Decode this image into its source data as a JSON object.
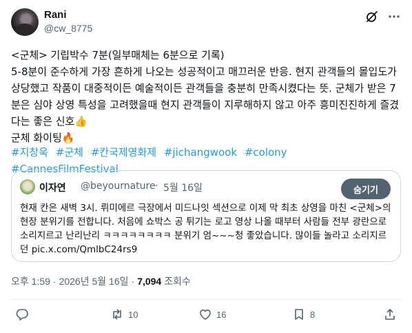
{
  "tweet": {
    "author_name": "Rani",
    "author_handle": "@cw_8775",
    "text": "<군체> 기립박수 7분(일부매체는 6분으로 기록)\n5-8분이 준수하게 가장 흔하게 나오는 성공적이고 매끄러운 반응. 현지 관객들의 몰입도가 상당했고 작품이 대중적이든 예술적이든 관객들을 충분히 만족시켰다는 뜻. 군체가 받은 7분은 심야 상영 특성을 고려했을때 현지 관객들이 지루해하지 않고 아주 흥미진진하게 즐겼다는 좋은 신호👍\n군체 화이팅🔥",
    "hashtags": [
      "#지창욱",
      "#군체",
      "#칸국제영화제",
      "#jichangwook",
      "#colony",
      "#CannesFilmFestival"
    ],
    "time": "오후 1:59",
    "date": "2026년 5월 16일",
    "views_count": "7,094",
    "views_label": "조회수"
  },
  "quote": {
    "author_name": "이자연",
    "author_handle": "@beyournature",
    "dot": "·",
    "date": "5월 16일",
    "hide_label": "숨기기",
    "text": "현재 칸은 새벽 3시. 뤼미에르 극장에서 미드나잇 섹션으로 이제 막 최초 상영을 마친 <군체>의 현장 분위기를 전합니다. 처음에 쇼박스 공 튀기는 로고 영상 나올 때부터 사람들 전부 광란으로 소리지르고 난리난리 ㅋㅋㅋㅋㅋㅋㅋㅋ 분위기 엄~~~청 좋았습니다. 많이들 놀라고 소리지르던 pic.x.com/QmlbC24rs9"
  },
  "actions": {
    "replies": "",
    "retweets": "10",
    "likes": "16",
    "bookmarks": "8"
  },
  "colors": {
    "link": "#1d9bf0",
    "secondary_text": "#536471",
    "border": "#cfd9de"
  },
  "icons": [
    "grok-icon",
    "more-icon",
    "reply-icon",
    "retweet-icon",
    "like-icon",
    "bookmark-icon",
    "share-icon"
  ]
}
